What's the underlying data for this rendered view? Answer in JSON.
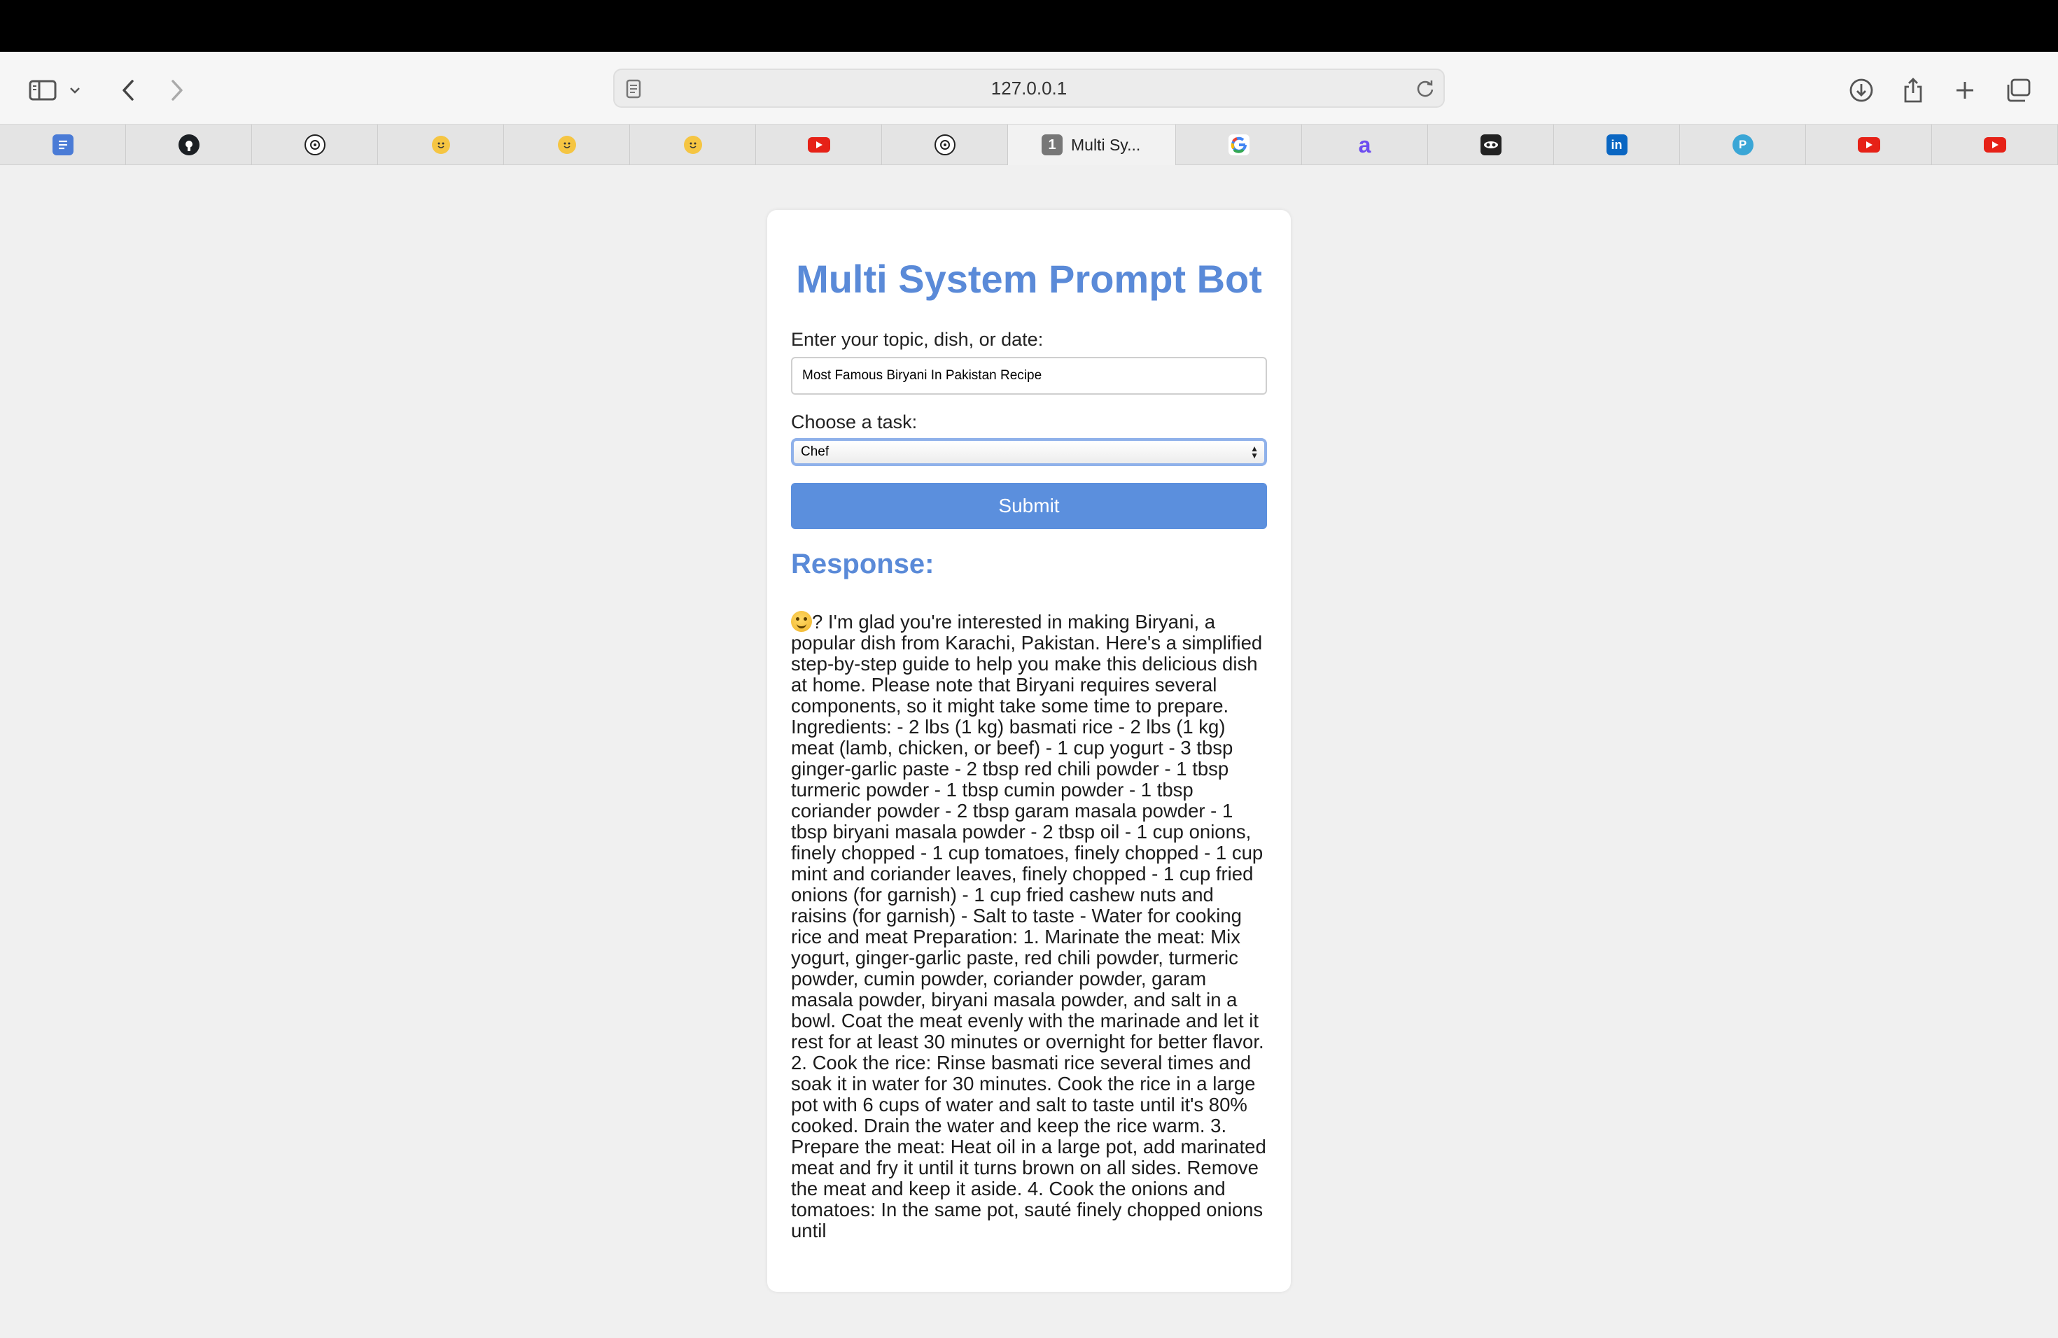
{
  "browser": {
    "url": "127.0.0.1",
    "active_tab": {
      "badge": "1",
      "title": "Multi Sy..."
    },
    "tabs": [
      {
        "icon": "google-docs-icon",
        "color": "#4a7bd6"
      },
      {
        "icon": "github-icon",
        "color": "#1b1f23"
      },
      {
        "icon": "chatgpt-icon",
        "color": "#222222"
      },
      {
        "icon": "huggingface-icon",
        "color": "#f5c542"
      },
      {
        "icon": "huggingface-icon",
        "color": "#f5c542"
      },
      {
        "icon": "huggingface-icon",
        "color": "#f5c542"
      },
      {
        "icon": "youtube-icon",
        "color": "#e62117"
      },
      {
        "icon": "chatgpt-icon",
        "color": "#222222"
      },
      {
        "icon": "active-tab"
      },
      {
        "icon": "google-icon",
        "color": "#4285f4"
      },
      {
        "icon": "a-logo-icon",
        "color": "#6c4cf0"
      },
      {
        "icon": "mask-icon",
        "color": "#222222"
      },
      {
        "icon": "linkedin-icon",
        "color": "#0a66c2"
      },
      {
        "icon": "p-circle-icon",
        "color": "#3aa6d6"
      },
      {
        "icon": "youtube-icon",
        "color": "#e62117"
      },
      {
        "icon": "youtube-icon",
        "color": "#e62117"
      }
    ]
  },
  "app": {
    "title": "Multi System Prompt Bot",
    "topic_label": "Enter your topic, dish, or date:",
    "topic_value": "Most Famous Biryani In Pakistan Recipe",
    "task_label": "Choose a task:",
    "task_selected": "Chef",
    "submit_label": "Submit",
    "response_heading": "Response:",
    "response_text": "? I'm glad you're interested in making Biryani, a popular dish from Karachi, Pakistan. Here's a simplified step-by-step guide to help you make this delicious dish at home. Please note that Biryani requires several components, so it might take some time to prepare. Ingredients: - 2 lbs (1 kg) basmati rice - 2 lbs (1 kg) meat (lamb, chicken, or beef) - 1 cup yogurt - 3 tbsp ginger-garlic paste - 2 tbsp red chili powder - 1 tbsp turmeric powder - 1 tbsp cumin powder - 1 tbsp coriander powder - 2 tbsp garam masala powder - 1 tbsp biryani masala powder - 2 tbsp oil - 1 cup onions, finely chopped - 1 cup tomatoes, finely chopped - 1 cup mint and coriander leaves, finely chopped - 1 cup fried onions (for garnish) - 1 cup fried cashew nuts and raisins (for garnish) - Salt to taste - Water for cooking rice and meat Preparation: 1. Marinate the meat: Mix yogurt, ginger-garlic paste, red chili powder, turmeric powder, cumin powder, coriander powder, garam masala powder, biryani masala powder, and salt in a bowl. Coat the meat evenly with the marinade and let it rest for at least 30 minutes or overnight for better flavor. 2. Cook the rice: Rinse basmati rice several times and soak it in water for 30 minutes. Cook the rice in a large pot with 6 cups of water and salt to taste until it's 80% cooked. Drain the water and keep the rice warm. 3. Prepare the meat: Heat oil in a large pot, add marinated meat and fry it until it turns brown on all sides. Remove the meat and keep it aside. 4. Cook the onions and tomatoes: In the same pot, sauté finely chopped onions until"
  },
  "colors": {
    "accent": "#5a8ad8",
    "button": "#5b8fdd"
  }
}
